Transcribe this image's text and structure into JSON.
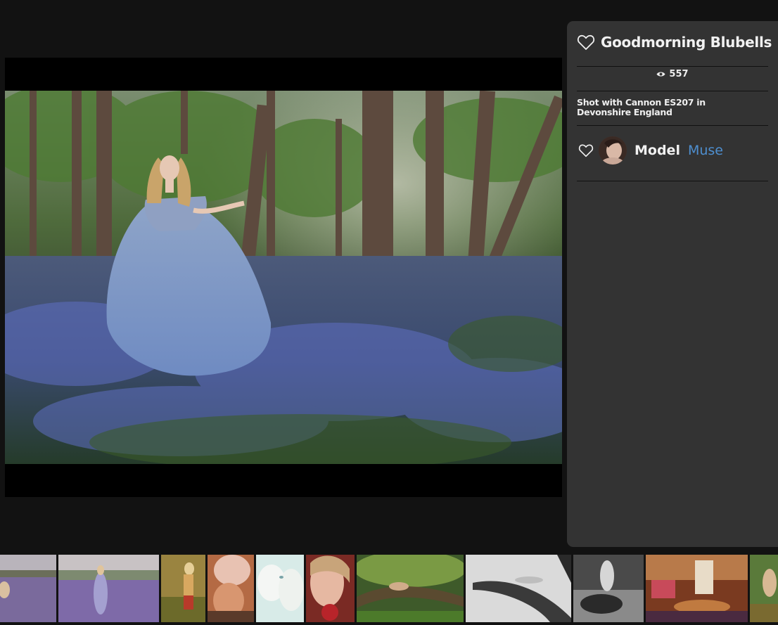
{
  "photo": {
    "title": "Goodmorning Blubells",
    "views": "557",
    "description": "Shot with Cannon ES207 in Devonshire England",
    "credit_role": "Model",
    "credit_name": "Muse"
  },
  "icons": {
    "like": "heart-outline-icon",
    "views": "eye-icon",
    "credit_like": "heart-outline-icon"
  },
  "colors": {
    "background": "#121212",
    "panel": "#333333",
    "link": "#4e8fd0",
    "text": "#f1f1f1"
  },
  "thumbnails": [
    {
      "label": "lavender-field-portrait"
    },
    {
      "label": "lavender-field-dress"
    },
    {
      "label": "golden-field-figure"
    },
    {
      "label": "warm-toned-portrait"
    },
    {
      "label": "white-flower-portrait"
    },
    {
      "label": "red-rose-portrait"
    },
    {
      "label": "forest-tree-figure"
    },
    {
      "label": "driftwood-figure-bw"
    },
    {
      "label": "waterfall-figure-bw"
    },
    {
      "label": "yurt-interior"
    },
    {
      "label": "meadow-figure"
    }
  ]
}
